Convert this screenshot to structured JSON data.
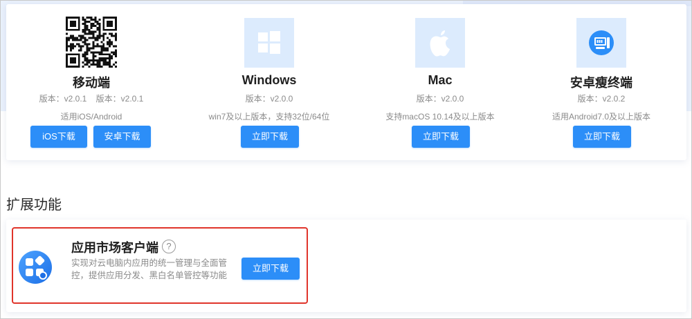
{
  "downloads": [
    {
      "name": "移动端",
      "icon": "qr-code-icon",
      "version": "版本：v2.0.1    版本：v2.0.1",
      "note": "适用iOS/Android",
      "buttons": [
        "iOS下载",
        "安卓下载"
      ]
    },
    {
      "name": "Windows",
      "icon": "windows-icon",
      "version": "版本：v2.0.0",
      "note": "win7及以上版本，支持32位/64位",
      "buttons": [
        "立即下载"
      ]
    },
    {
      "name": "Mac",
      "icon": "apple-icon",
      "version": "版本：v2.0.0",
      "note": "支持macOS 10.14及以上版本",
      "buttons": [
        "立即下载"
      ]
    },
    {
      "name": "安卓瘦终端",
      "icon": "android-thin-client-icon",
      "version": "版本：v2.0.2",
      "note": "适用Android7.0及以上版本",
      "buttons": [
        "立即下载"
      ]
    }
  ],
  "extensions": {
    "section_title": "扩展功能",
    "item": {
      "icon": "app-market-icon",
      "title": "应用市场客户端",
      "help": "?",
      "description": "实现对云电脑内应用的统一管理与全面管控，提供应用分发、黑白名单管控等功能",
      "button": "立即下载"
    }
  },
  "colors": {
    "accent": "#2c8ef8",
    "highlight": "#e0342a",
    "tile": "#dcebfd"
  }
}
